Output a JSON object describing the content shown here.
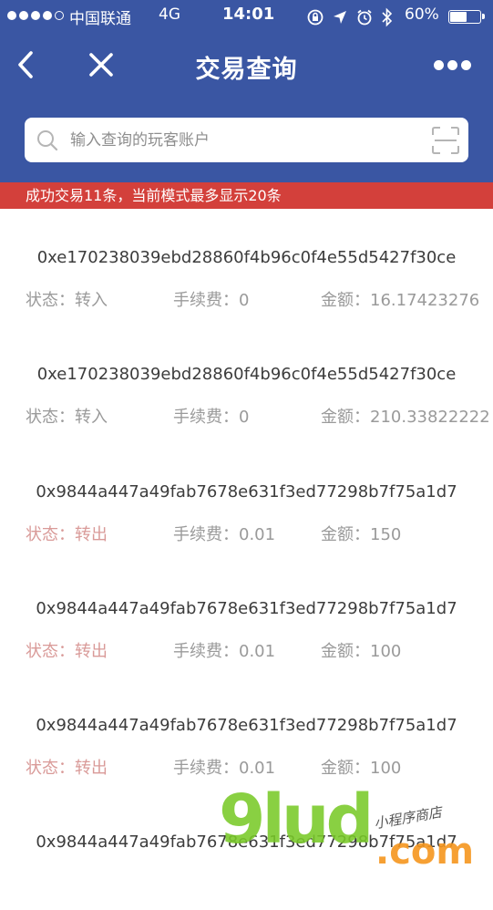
{
  "status_bar": {
    "carrier": "中国联通",
    "network": "4G",
    "time": "14:01",
    "battery_percent": "60%",
    "battery_level": 0.6,
    "signal_dots_filled": 4,
    "icons": [
      "orientation-lock-icon",
      "location-icon",
      "alarm-icon",
      "bluetooth-icon"
    ]
  },
  "nav": {
    "title": "交易查询",
    "back_icon": "chevron-left-icon",
    "close_icon": "close-icon",
    "more_icon": "more-dots-icon"
  },
  "search": {
    "placeholder": "输入查询的玩客账户",
    "value": "",
    "search_icon": "search-icon",
    "scan_icon": "scan-icon"
  },
  "notice": {
    "text": "成功交易11条，当前模式最多显示20条",
    "color": "#d3403b"
  },
  "colors": {
    "header": "#3a56a3",
    "hash_text": "#3c3c3c",
    "field_text": "#9a9a9a",
    "status_out": "#d99a98"
  },
  "transactions": [
    {
      "hash": "0xe170238039ebd28860f4b96c0f4e55d5427f30ce",
      "status": "状态：转入",
      "fee": "手续费：0",
      "amount": "金额：16.17423276"
    },
    {
      "hash": "0xe170238039ebd28860f4b96c0f4e55d5427f30ce",
      "status": "状态：转入",
      "fee": "手续费：0",
      "amount": "金额：210.33822222"
    },
    {
      "hash": "0x9844a447a49fab7678e631f3ed77298b7f75a1d7",
      "status": "状态：转出",
      "fee": "手续费：0.01",
      "amount": "金额：150"
    },
    {
      "hash": "0x9844a447a49fab7678e631f3ed77298b7f75a1d7",
      "status": "状态：转出",
      "fee": "手续费：0.01",
      "amount": "金额：100"
    },
    {
      "hash": "0x9844a447a49fab7678e631f3ed77298b7f75a1d7",
      "status": "状态：转出",
      "fee": "手续费：0.01",
      "amount": "金额：100"
    },
    {
      "hash": "0x9844a447a49fab7678e631f3ed77298b7f75a1d7",
      "status": "",
      "fee": "",
      "amount": ""
    }
  ],
  "watermark": {
    "main": "9lud",
    "tld": ".com",
    "sub": "小程序商店"
  }
}
